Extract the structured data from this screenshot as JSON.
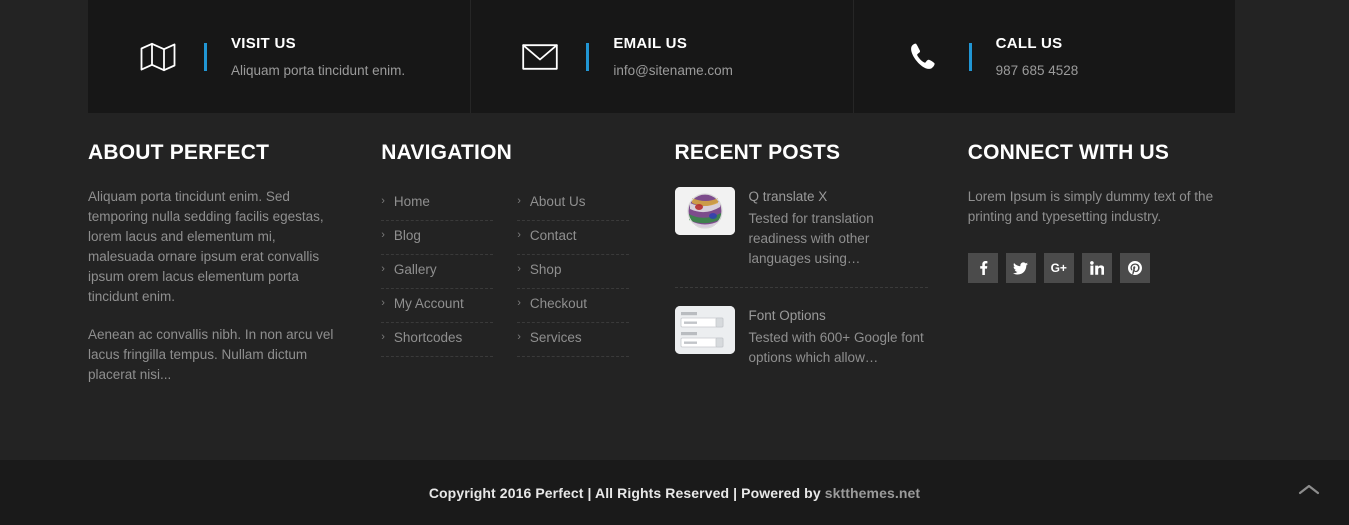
{
  "contact_bar": {
    "blocks": [
      {
        "icon": "map-icon",
        "title": "VISIT US",
        "subtitle": "Aliquam porta tincidunt enim."
      },
      {
        "icon": "envelope-icon",
        "title": "EMAIL US",
        "subtitle": "info@sitename.com"
      },
      {
        "icon": "phone-icon",
        "title": "CALL US",
        "subtitle": "987 685 4528"
      }
    ],
    "accent_color": "#2196d4",
    "background": "#171717"
  },
  "about": {
    "title": "ABOUT PERFECT",
    "paragraphs": [
      "Aliquam porta tincidunt enim. Sed temporing nulla sedding facilis egestas, lorem lacus and elementum mi, malesuada ornare ipsum erat convallis ipsum orem lacus elementum porta tincidunt enim.",
      "Aenean ac convallis nibh. In non arcu vel lacus fringilla tempus. Nullam dictum placerat nisi..."
    ]
  },
  "navigation": {
    "title": "NAVIGATION",
    "chevron": "›",
    "column_left": [
      {
        "label": "Home"
      },
      {
        "label": "Blog"
      },
      {
        "label": "Gallery"
      },
      {
        "label": "My Account"
      },
      {
        "label": "Shortcodes"
      }
    ],
    "column_right": [
      {
        "label": "About Us"
      },
      {
        "label": "Contact"
      },
      {
        "label": "Shop"
      },
      {
        "label": "Checkout"
      },
      {
        "label": "Services"
      }
    ]
  },
  "recent_posts": {
    "title": "RECENT POSTS",
    "posts": [
      {
        "thumb": "flag-globe-thumbnail",
        "title": "Q translate X",
        "excerpt": "Tested for translation readiness with other languages using…"
      },
      {
        "thumb": "form-options-thumbnail",
        "title": "Font Options",
        "excerpt": "Tested with 600+ Google font options which allow…"
      }
    ]
  },
  "connect": {
    "title": "CONNECT WITH US",
    "description": "Lorem Ipsum is simply dummy text of the printing and typesetting industry.",
    "socials": [
      {
        "name": "facebook",
        "label": "f"
      },
      {
        "name": "twitter",
        "label": "t"
      },
      {
        "name": "google-plus",
        "label": "G+"
      },
      {
        "name": "linkedin",
        "label": "in"
      },
      {
        "name": "pinterest",
        "label": "P"
      }
    ],
    "social_background": "#4b4b4b"
  },
  "footer": {
    "copyright_main": "Copyright 2016 Perfect | All Rights Reserved | Powered by ",
    "credit": "sktthemes.net",
    "background": "#1a1a1a"
  },
  "scroll_top": {
    "icon": "chevron-up-icon"
  }
}
